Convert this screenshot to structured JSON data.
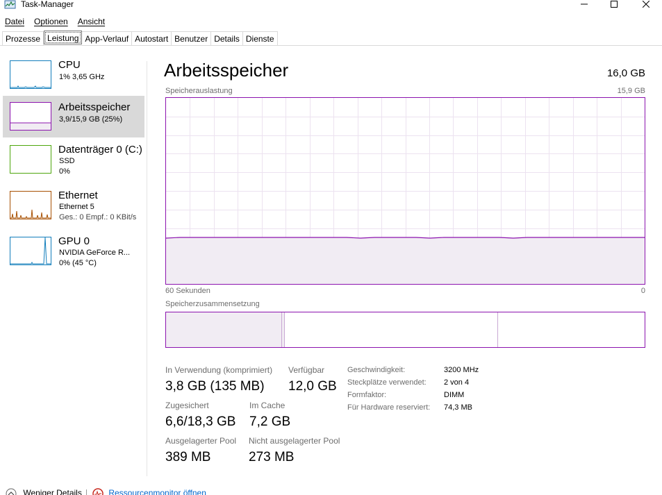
{
  "window": {
    "title": "Task-Manager"
  },
  "menu": {
    "items": [
      "Datei",
      "Optionen",
      "Ansicht"
    ]
  },
  "tabs": [
    "Prozesse",
    "Leistung",
    "App-Verlauf",
    "Autostart",
    "Benutzer",
    "Details",
    "Dienste"
  ],
  "active_tab": "Leistung",
  "sidebar": {
    "items": [
      {
        "title": "CPU",
        "sub1": "1% 3,65 GHz",
        "sub2": "",
        "color": "#117dbb",
        "icon": "cpu-graph"
      },
      {
        "title": "Arbeitsspeicher",
        "sub1": "3,9/15,9 GB (25%)",
        "sub2": "",
        "color": "#8b12ae",
        "icon": "memory-graph",
        "selected": true
      },
      {
        "title": "Datenträger 0 (C:)",
        "sub1": "SSD",
        "sub2": "0%",
        "color": "#4da60c",
        "icon": "disk-graph"
      },
      {
        "title": "Ethernet",
        "sub1": "Ethernet 5",
        "sub2": "Ges.: 0 Empf.: 0 KBit/s",
        "color": "#a74f01",
        "icon": "ethernet-graph"
      },
      {
        "title": "GPU 0",
        "sub1": "NVIDIA GeForce R...",
        "sub2": "0% (45 °C)",
        "color": "#117dbb",
        "icon": "gpu-graph"
      }
    ]
  },
  "main": {
    "title": "Arbeitsspeicher",
    "total": "16,0 GB",
    "usage_label": "Speicherauslastung",
    "usage_max": "15,9 GB",
    "time_left": "60 Sekunden",
    "time_right": "0",
    "composition_label": "Speicherzusammensetzung",
    "usage_fraction": 0.25,
    "accent": "#8b12ae"
  },
  "stats": {
    "in_use_label": "In Verwendung (komprimiert)",
    "in_use_value": "3,8 GB (135 MB)",
    "available_label": "Verfügbar",
    "available_value": "12,0 GB",
    "committed_label": "Zugesichert",
    "committed_value": "6,6/18,3 GB",
    "cached_label": "Im Cache",
    "cached_value": "7,2 GB",
    "paged_label": "Ausgelagerter Pool",
    "paged_value": "389 MB",
    "nonpaged_label": "Nicht ausgelagerter Pool",
    "nonpaged_value": "273 MB"
  },
  "specs": [
    {
      "label": "Geschwindigkeit:",
      "value": "3200 MHz"
    },
    {
      "label": "Steckplätze verwendet:",
      "value": "2 von 4"
    },
    {
      "label": "Formfaktor:",
      "value": "DIMM"
    },
    {
      "label": "Für Hardware reserviert:",
      "value": "74,3 MB"
    }
  ],
  "footer": {
    "less_details": "Weniger Details",
    "resource_monitor": "Ressourcenmonitor öffnen"
  }
}
